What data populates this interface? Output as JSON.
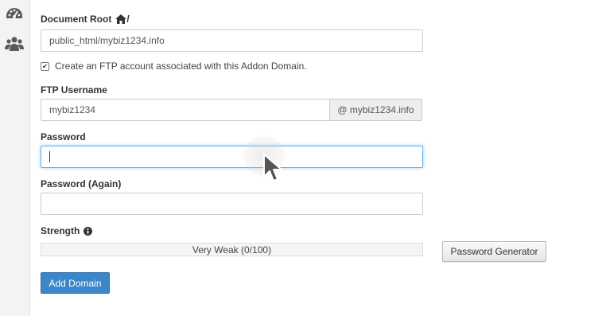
{
  "sidebar": {
    "items": [
      {
        "icon": "dashboard-icon"
      },
      {
        "icon": "users-icon"
      }
    ]
  },
  "form": {
    "document_root": {
      "label": "Document Root",
      "suffix": "/",
      "value": "public_html/mybiz1234.info"
    },
    "ftp_checkbox": {
      "checked": true,
      "label": "Create an FTP account associated with this Addon Domain."
    },
    "ftp_username": {
      "label": "FTP Username",
      "value": "mybiz1234",
      "domain_addon": "@ mybiz1234.info"
    },
    "password": {
      "label": "Password",
      "value": ""
    },
    "password_again": {
      "label": "Password (Again)",
      "value": ""
    },
    "strength": {
      "label": "Strength",
      "meter_text": "Very Weak (0/100)",
      "score": 0
    },
    "password_generator_label": "Password Generator",
    "add_domain_label": "Add Domain"
  },
  "colors": {
    "primary": "#3c87c9",
    "focus": "#66afe9"
  }
}
